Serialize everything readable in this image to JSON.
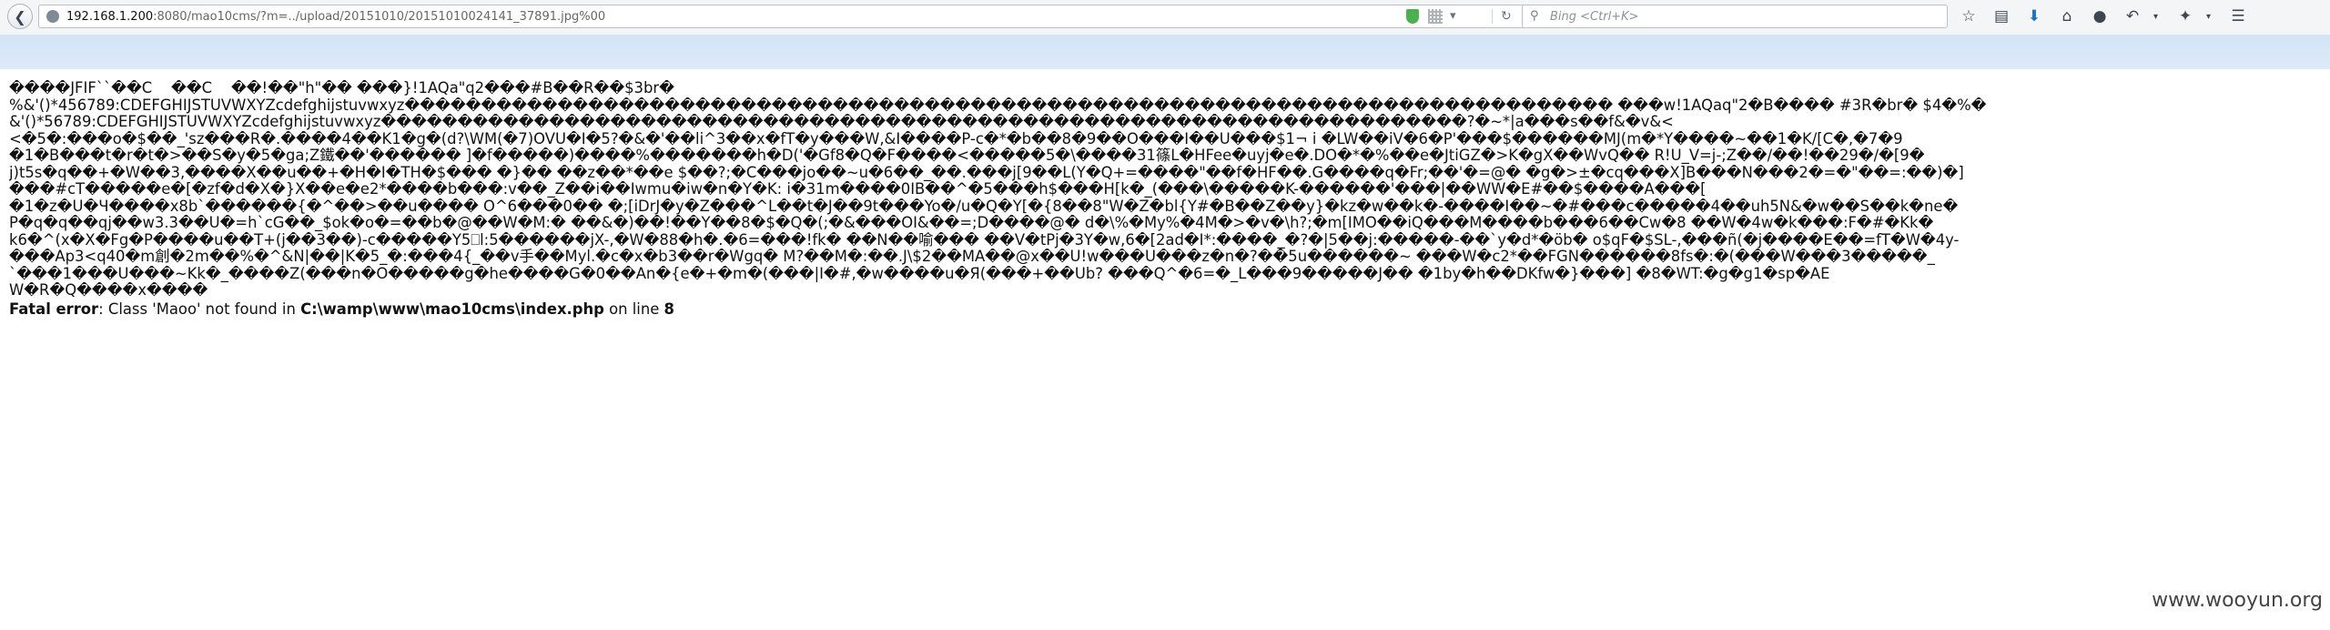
{
  "browser": {
    "url_host": "192.168.1.200",
    "url_rest": ":8080/mao10cms/?m=../upload/20151010/20151010024141_37891.jpg%00",
    "search_placeholder": "Bing <Ctrl+K>",
    "icons": [
      "back-icon",
      "globe-icon",
      "shield-icon",
      "grid-icon",
      "dropdown-icon",
      "reload-icon",
      "search-icon",
      "bookmark-star-icon",
      "bookmarks-icon",
      "download-icon",
      "home-icon",
      "chat-icon",
      "undo-icon",
      "extension-icon",
      "menu-icon"
    ]
  },
  "content": {
    "garbled_lines": [
      "����JFIF``��C    ��C    ��!��\"h\"�� ���}!1AQa\"q2���#B��R��$3br�",
      "%&'()*456789:CDEFGHIJSTUVWXYZcdefghijstuvwxyz������������������������������������������������������������������������������� ���w!1AQaq\"2�B���� #3R�br� $4�%�",
      "&'()*56789:CDEFGHIJSTUVWXYZcdefghijstuvwxyz�����������������������������������������������������������������������?�~*|a���s��f&�v&<",
      "<�5�:���o�$��_'sz���R�.����4��K1�g�(d?\\WM(�7)OVU�I�5?�&�'��li^3��x�fT�y���W,&I����P-c�*�b��8�9��O���I��U���$1¬ i �LW��iV�6�P'���$������MJ(m�*Y����~��1�K/[C�,�7�9",
      "�1�B���t�r�t�>��S�y�5�ga;Z鐵��'������ ]�f�����)����%�������h�D('�Gf8�Q�F����<�����5�\\����31篠L�HFee�uyj�e�.DO�*�%��e�JtiGZ�>K�gX��WvQ�� R!U_V=j-;Z��/��!��29�/�[9�",
      "j)t5s�q��+�W��3,����X��u��+�H�I�TH�$���  �}��  ��z��*��e $��?;�C���jo��~u�6��_��.���j[9��L(Y�Q+=����\"��f�HF��.G����q�Fr;��'�=@�  �g�>±�cq���X]B���N���2�=�\"��=:��)�]",
      "���#cT�����e�[�zf�d�X�}X��e�e2*����b���:v��_Z��i��Iwmu�iw�n�Y�K: i�31m����0IB��^�5���h$���H[k�_(���\\�����K-������'���|��WW�E#��$����A���[",
      "�1�z�U�Ч����x8b`������{�^��>��u���� O^6���0�� �;[iDrJ�y�Z���^L��t�J��9t���Yo�/u�Q�Ÿ[�{8��8\"W�Z�bl{Y#�B��Z��y}�kz�w��k�-����I��~�#���c�����4��uh5N&�w��S��k�ne�",
      "P�q�q��qj��w3.3��U�=h`cG��_$ok�o�=��b�@��W�M:� ��&�)��!��Y��8�$�Q�(;�&���OI&��=;D����@� d�\\%�My%�4M�>�v�\\h?;�m[IMO��iQ���M����b���6��Cw�8 ��W�4w�k���:F�#�Kk�",
      "k6�^(x�X�Fg�P����u��T+(j��3��)-c�����Y5⎕l:5������jX-,�W�88�h�.�6=���!fk� ��N��喻��� ��V�tPj�3Y�w,6�[2ad�I*:����_�?�|5��j:�����-��`y�d*�öb� o$qF�$SL-,���ñ(�j����E��=fT�W�4y-",
      "���Ap3<q40�m創�2m��%�^&N|��|K�5_�:���4{_��v手��Myl.�c�x�b3��r�Wgq� M?��M�:��.J\\$2��MA��@x��U!w���U���z�n�?��5u������~ ���W�c2*��FGN������8fs�:�(���W���3�����_",
      "`���1���U���~Kk�_����Z(���n�O�����g�he����G�0��An�{e�+�m�(���|I�#,�w����u�Я(���+��Ub? ���Q^�6=�_L���9�����J�� �1by�h��DKfw�}���] �8�WT:�g�g1�sp�AE",
      "W�R�Q����x����"
    ],
    "error_label": "Fatal error",
    "error_message": ": Class 'Maoo' not found in ",
    "error_file": "C:\\wamp\\www\\mao10cms\\index.php",
    "error_line_prefix": " on line ",
    "error_line": "8"
  },
  "watermark": "www.wooyun.org"
}
